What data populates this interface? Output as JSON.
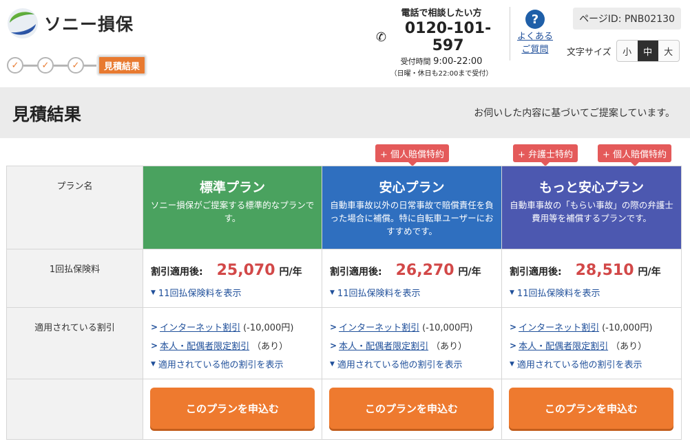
{
  "header": {
    "logo_text": "ソニー損保",
    "steps_done": [
      "✓",
      "✓",
      "✓"
    ],
    "step_current": "見積結果",
    "phone": {
      "title": "電話で相談したい方",
      "number": "0120-101-597",
      "hours_label": "受付時間",
      "hours": "9:00-22:00",
      "note": "（日曜・休日も22:00まで受付）"
    },
    "faq": {
      "icon": "?",
      "line1": "よくある",
      "line2": "ご質問"
    },
    "page_id": "ページID: PNB02130",
    "font_size": {
      "label": "文字サイズ",
      "options": [
        "小",
        "中",
        "大"
      ],
      "selected": "中"
    }
  },
  "title_band": {
    "title": "見積結果",
    "subtitle": "お伺いした内容に基づいてご提案しています。"
  },
  "badges": {
    "plan2": [
      "+ 個人賠償特約"
    ],
    "plan3": [
      "+ 弁護士特約",
      "+ 個人賠償特約"
    ]
  },
  "row_labels": {
    "plan_name": "プラン名",
    "premium": "1回払保険料",
    "discounts": "適用されている割引"
  },
  "plans": [
    {
      "name": "標準プラン",
      "desc": "ソニー損保がご提案する標準的なプランです。",
      "color": "#4aa25f",
      "price_prefix": "割引適用後:",
      "price": "25,070",
      "unit": "円/年",
      "monthly_link": "11回払保険料を表示",
      "discounts": [
        {
          "name": "インターネット割引",
          "note": "(-10,000円)"
        },
        {
          "name": "本人・配偶者限定割引",
          "note": "（あり）"
        }
      ],
      "other_discounts_link": "適用されている他の割引を表示",
      "apply": "このプランを申込む"
    },
    {
      "name": "安心プラン",
      "desc": "自動車事故以外の日常事故で賠償責任を負った場合に補償。特に自転車ユーザーにおすすめです。",
      "color": "#2f6fbf",
      "price_prefix": "割引適用後:",
      "price": "26,270",
      "unit": "円/年",
      "monthly_link": "11回払保険料を表示",
      "discounts": [
        {
          "name": "インターネット割引",
          "note": "(-10,000円)"
        },
        {
          "name": "本人・配偶者限定割引",
          "note": "（あり）"
        }
      ],
      "other_discounts_link": "適用されている他の割引を表示",
      "apply": "このプランを申込む"
    },
    {
      "name": "もっと安心プラン",
      "desc": "自動車事故の「もらい事故」の際の弁護士費用等を補償するプランです。",
      "color": "#4c58b0",
      "price_prefix": "割引適用後:",
      "price": "28,510",
      "unit": "円/年",
      "monthly_link": "11回払保険料を表示",
      "discounts": [
        {
          "name": "インターネット割引",
          "note": "(-10,000円)"
        },
        {
          "name": "本人・配偶者限定割引",
          "note": "（あり）"
        }
      ],
      "other_discounts_link": "適用されている他の割引を表示",
      "apply": "このプランを申込む"
    }
  ]
}
